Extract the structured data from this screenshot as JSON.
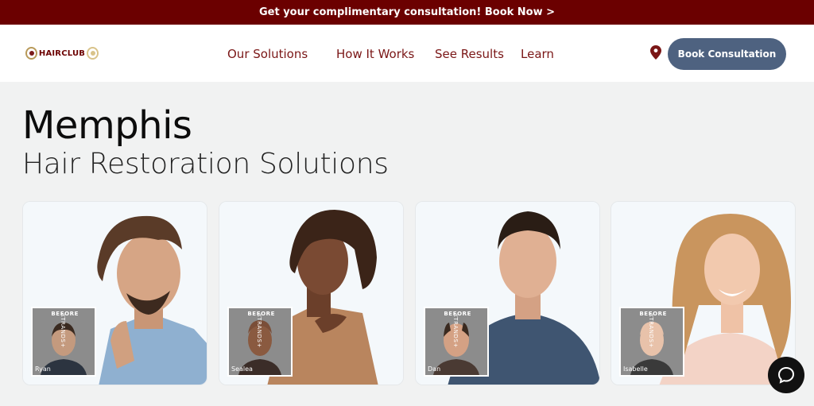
{
  "promo": {
    "text": "Get your complimentary consultation! Book Now >"
  },
  "logo": {
    "text": "HAIRCLUB"
  },
  "nav": {
    "items": [
      "Our Solutions",
      "How It Works",
      "See Results",
      "Learn"
    ],
    "book_label": "Book Consultation"
  },
  "hero": {
    "title": "Memphis",
    "subtitle": "Hair Restoration Solutions"
  },
  "cards": [
    {
      "before_label": "BEFORE",
      "brand": "XTRANDS+",
      "name": "Ryan"
    },
    {
      "before_label": "BEFORE",
      "brand": "XTRANDS+",
      "name": "Sealea"
    },
    {
      "before_label": "BEFORE",
      "brand": "XTRANDS+",
      "name": "Dan"
    },
    {
      "before_label": "BEFORE",
      "brand": "XTRANDS+",
      "name": "Isabelle"
    }
  ],
  "colors": {
    "promo_bg": "#6b0000",
    "accent": "#7a1616",
    "button": "#4e6280"
  },
  "icons": {
    "location": "location-pin-icon",
    "chat": "chat-icon"
  }
}
